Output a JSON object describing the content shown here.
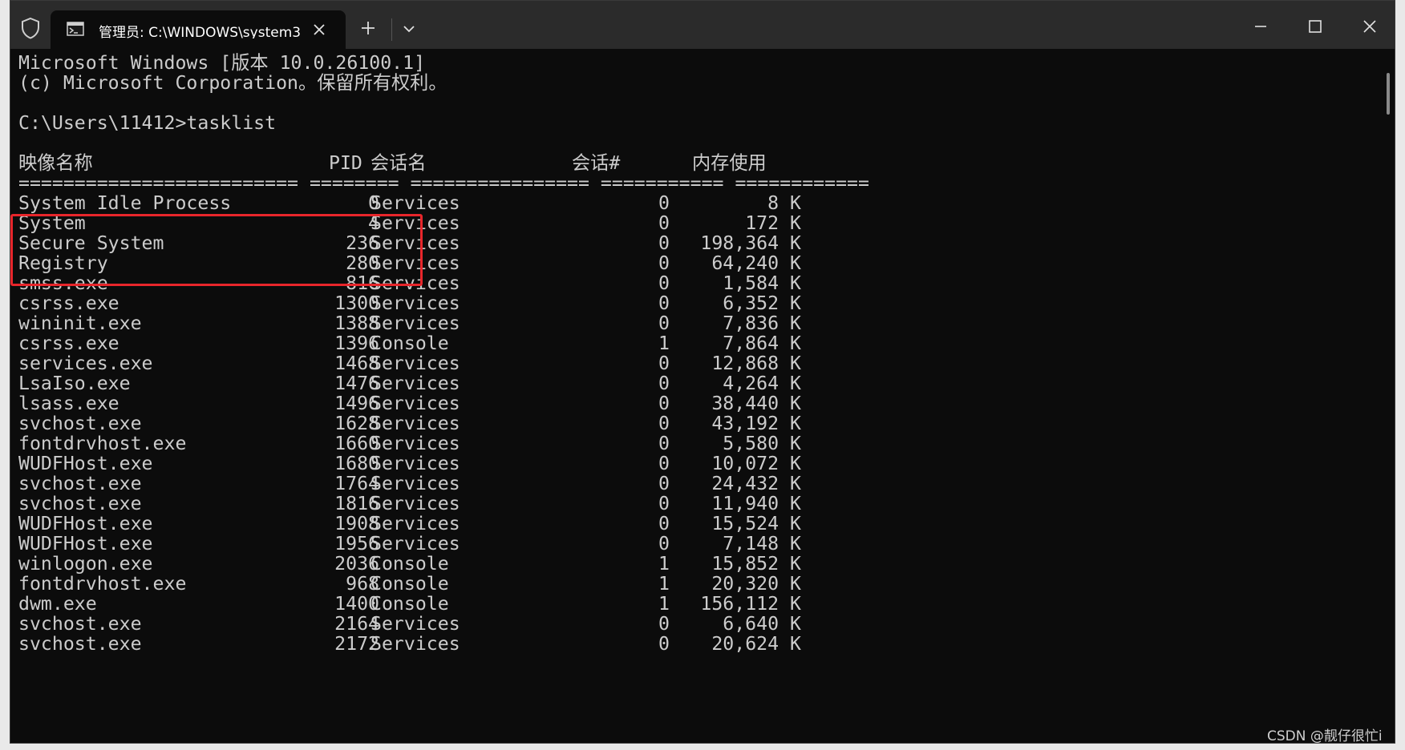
{
  "window": {
    "tab_title": "管理员: C:\\WINDOWS\\system3",
    "icons": [
      "shield-icon",
      "terminal-icon",
      "close-icon",
      "plus-icon",
      "chevron-down-icon",
      "minimize-icon",
      "maximize-icon",
      "close-icon"
    ]
  },
  "terminal": {
    "banner_line1": "Microsoft Windows [版本 10.0.26100.1]",
    "banner_line2": "(c) Microsoft Corporation。保留所有权利。",
    "prompt": "C:\\Users\\11412>tasklist",
    "headers": {
      "image_name": "映像名称",
      "pid": "PID",
      "session_name": "会话名",
      "session_num": "会话#",
      "mem_usage": "内存使用"
    },
    "separator": "========================= ======== ================ =========== ============",
    "rows": [
      {
        "name": "System Idle Process",
        "pid": "0",
        "session": "Services",
        "num": "0",
        "mem": "8 K"
      },
      {
        "name": "System",
        "pid": "4",
        "session": "Services",
        "num": "0",
        "mem": "172 K"
      },
      {
        "name": "Secure System",
        "pid": "236",
        "session": "Services",
        "num": "0",
        "mem": "198,364 K"
      },
      {
        "name": "Registry",
        "pid": "280",
        "session": "Services",
        "num": "0",
        "mem": "64,240 K"
      },
      {
        "name": "smss.exe",
        "pid": "816",
        "session": "Services",
        "num": "0",
        "mem": "1,584 K"
      },
      {
        "name": "csrss.exe",
        "pid": "1300",
        "session": "Services",
        "num": "0",
        "mem": "6,352 K"
      },
      {
        "name": "wininit.exe",
        "pid": "1388",
        "session": "Services",
        "num": "0",
        "mem": "7,836 K"
      },
      {
        "name": "csrss.exe",
        "pid": "1396",
        "session": "Console",
        "num": "1",
        "mem": "7,864 K"
      },
      {
        "name": "services.exe",
        "pid": "1468",
        "session": "Services",
        "num": "0",
        "mem": "12,868 K"
      },
      {
        "name": "LsaIso.exe",
        "pid": "1476",
        "session": "Services",
        "num": "0",
        "mem": "4,264 K"
      },
      {
        "name": "lsass.exe",
        "pid": "1496",
        "session": "Services",
        "num": "0",
        "mem": "38,440 K"
      },
      {
        "name": "svchost.exe",
        "pid": "1628",
        "session": "Services",
        "num": "0",
        "mem": "43,192 K"
      },
      {
        "name": "fontdrvhost.exe",
        "pid": "1660",
        "session": "Services",
        "num": "0",
        "mem": "5,580 K"
      },
      {
        "name": "WUDFHost.exe",
        "pid": "1680",
        "session": "Services",
        "num": "0",
        "mem": "10,072 K"
      },
      {
        "name": "svchost.exe",
        "pid": "1764",
        "session": "Services",
        "num": "0",
        "mem": "24,432 K"
      },
      {
        "name": "svchost.exe",
        "pid": "1816",
        "session": "Services",
        "num": "0",
        "mem": "11,940 K"
      },
      {
        "name": "WUDFHost.exe",
        "pid": "1908",
        "session": "Services",
        "num": "0",
        "mem": "15,524 K"
      },
      {
        "name": "WUDFHost.exe",
        "pid": "1956",
        "session": "Services",
        "num": "0",
        "mem": "7,148 K"
      },
      {
        "name": "winlogon.exe",
        "pid": "2036",
        "session": "Console",
        "num": "1",
        "mem": "15,852 K"
      },
      {
        "name": "fontdrvhost.exe",
        "pid": "968",
        "session": "Console",
        "num": "1",
        "mem": "20,320 K"
      },
      {
        "name": "dwm.exe",
        "pid": "1400",
        "session": "Console",
        "num": "1",
        "mem": "156,112 K"
      },
      {
        "name": "svchost.exe",
        "pid": "2164",
        "session": "Services",
        "num": "0",
        "mem": "6,640 K"
      },
      {
        "name": "svchost.exe",
        "pid": "2172",
        "session": "Services",
        "num": "0",
        "mem": "20,624 K"
      }
    ]
  },
  "watermark": "CSDN @靓仔很忙i",
  "colors": {
    "terminal_bg": "#0c0c0c",
    "text": "#cccccc",
    "titlebar": "#2b2b2b",
    "highlight_box": "#e8262b"
  }
}
